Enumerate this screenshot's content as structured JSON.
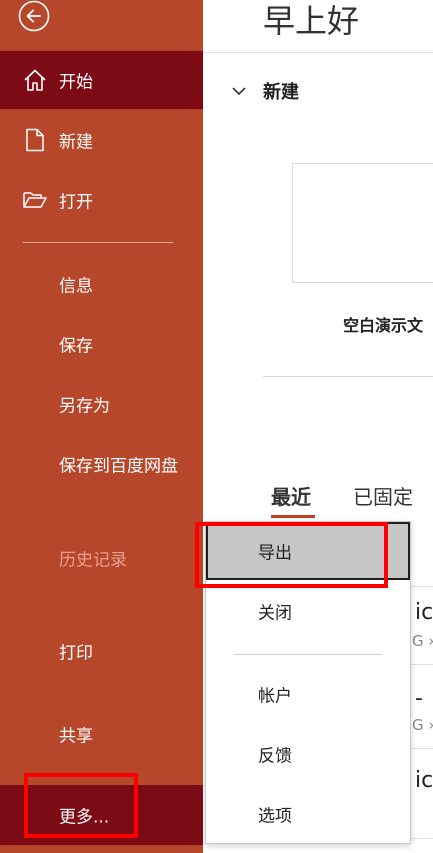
{
  "sidebar": {
    "items": [
      {
        "key": "home",
        "label": "开始",
        "icon": "home-icon",
        "active": true
      },
      {
        "key": "new",
        "label": "新建",
        "icon": "new-file-icon"
      },
      {
        "key": "open",
        "label": "打开",
        "icon": "folder-open-icon"
      },
      {
        "key": "info",
        "label": "信息"
      },
      {
        "key": "save",
        "label": "保存"
      },
      {
        "key": "save_as",
        "label": "另存为"
      },
      {
        "key": "save_baidu",
        "label": "保存到百度网盘"
      },
      {
        "key": "history",
        "label": "历史记录",
        "disabled": true
      },
      {
        "key": "print",
        "label": "打印"
      },
      {
        "key": "share",
        "label": "共享"
      },
      {
        "key": "more",
        "label": "更多..."
      }
    ]
  },
  "main": {
    "greeting": "早上好",
    "new_section": "新建",
    "template_label": "空白演示文",
    "tabs": [
      {
        "label": "最近",
        "active": true
      },
      {
        "label": "已固定"
      }
    ],
    "recent_fragments": [
      {
        "title": "ic",
        "sub": "G ›"
      },
      {
        "title": "-",
        "sub": "G ›"
      },
      {
        "title": "ic",
        "sub": ""
      }
    ]
  },
  "dropdown": {
    "items": [
      "导出",
      "关闭",
      "帐户",
      "反馈",
      "选项"
    ]
  },
  "colors": {
    "sidebar_bg": "#b7472a",
    "sidebar_active": "#7d0b16",
    "accent": "#c43e1c",
    "highlight": "#ff0000"
  }
}
